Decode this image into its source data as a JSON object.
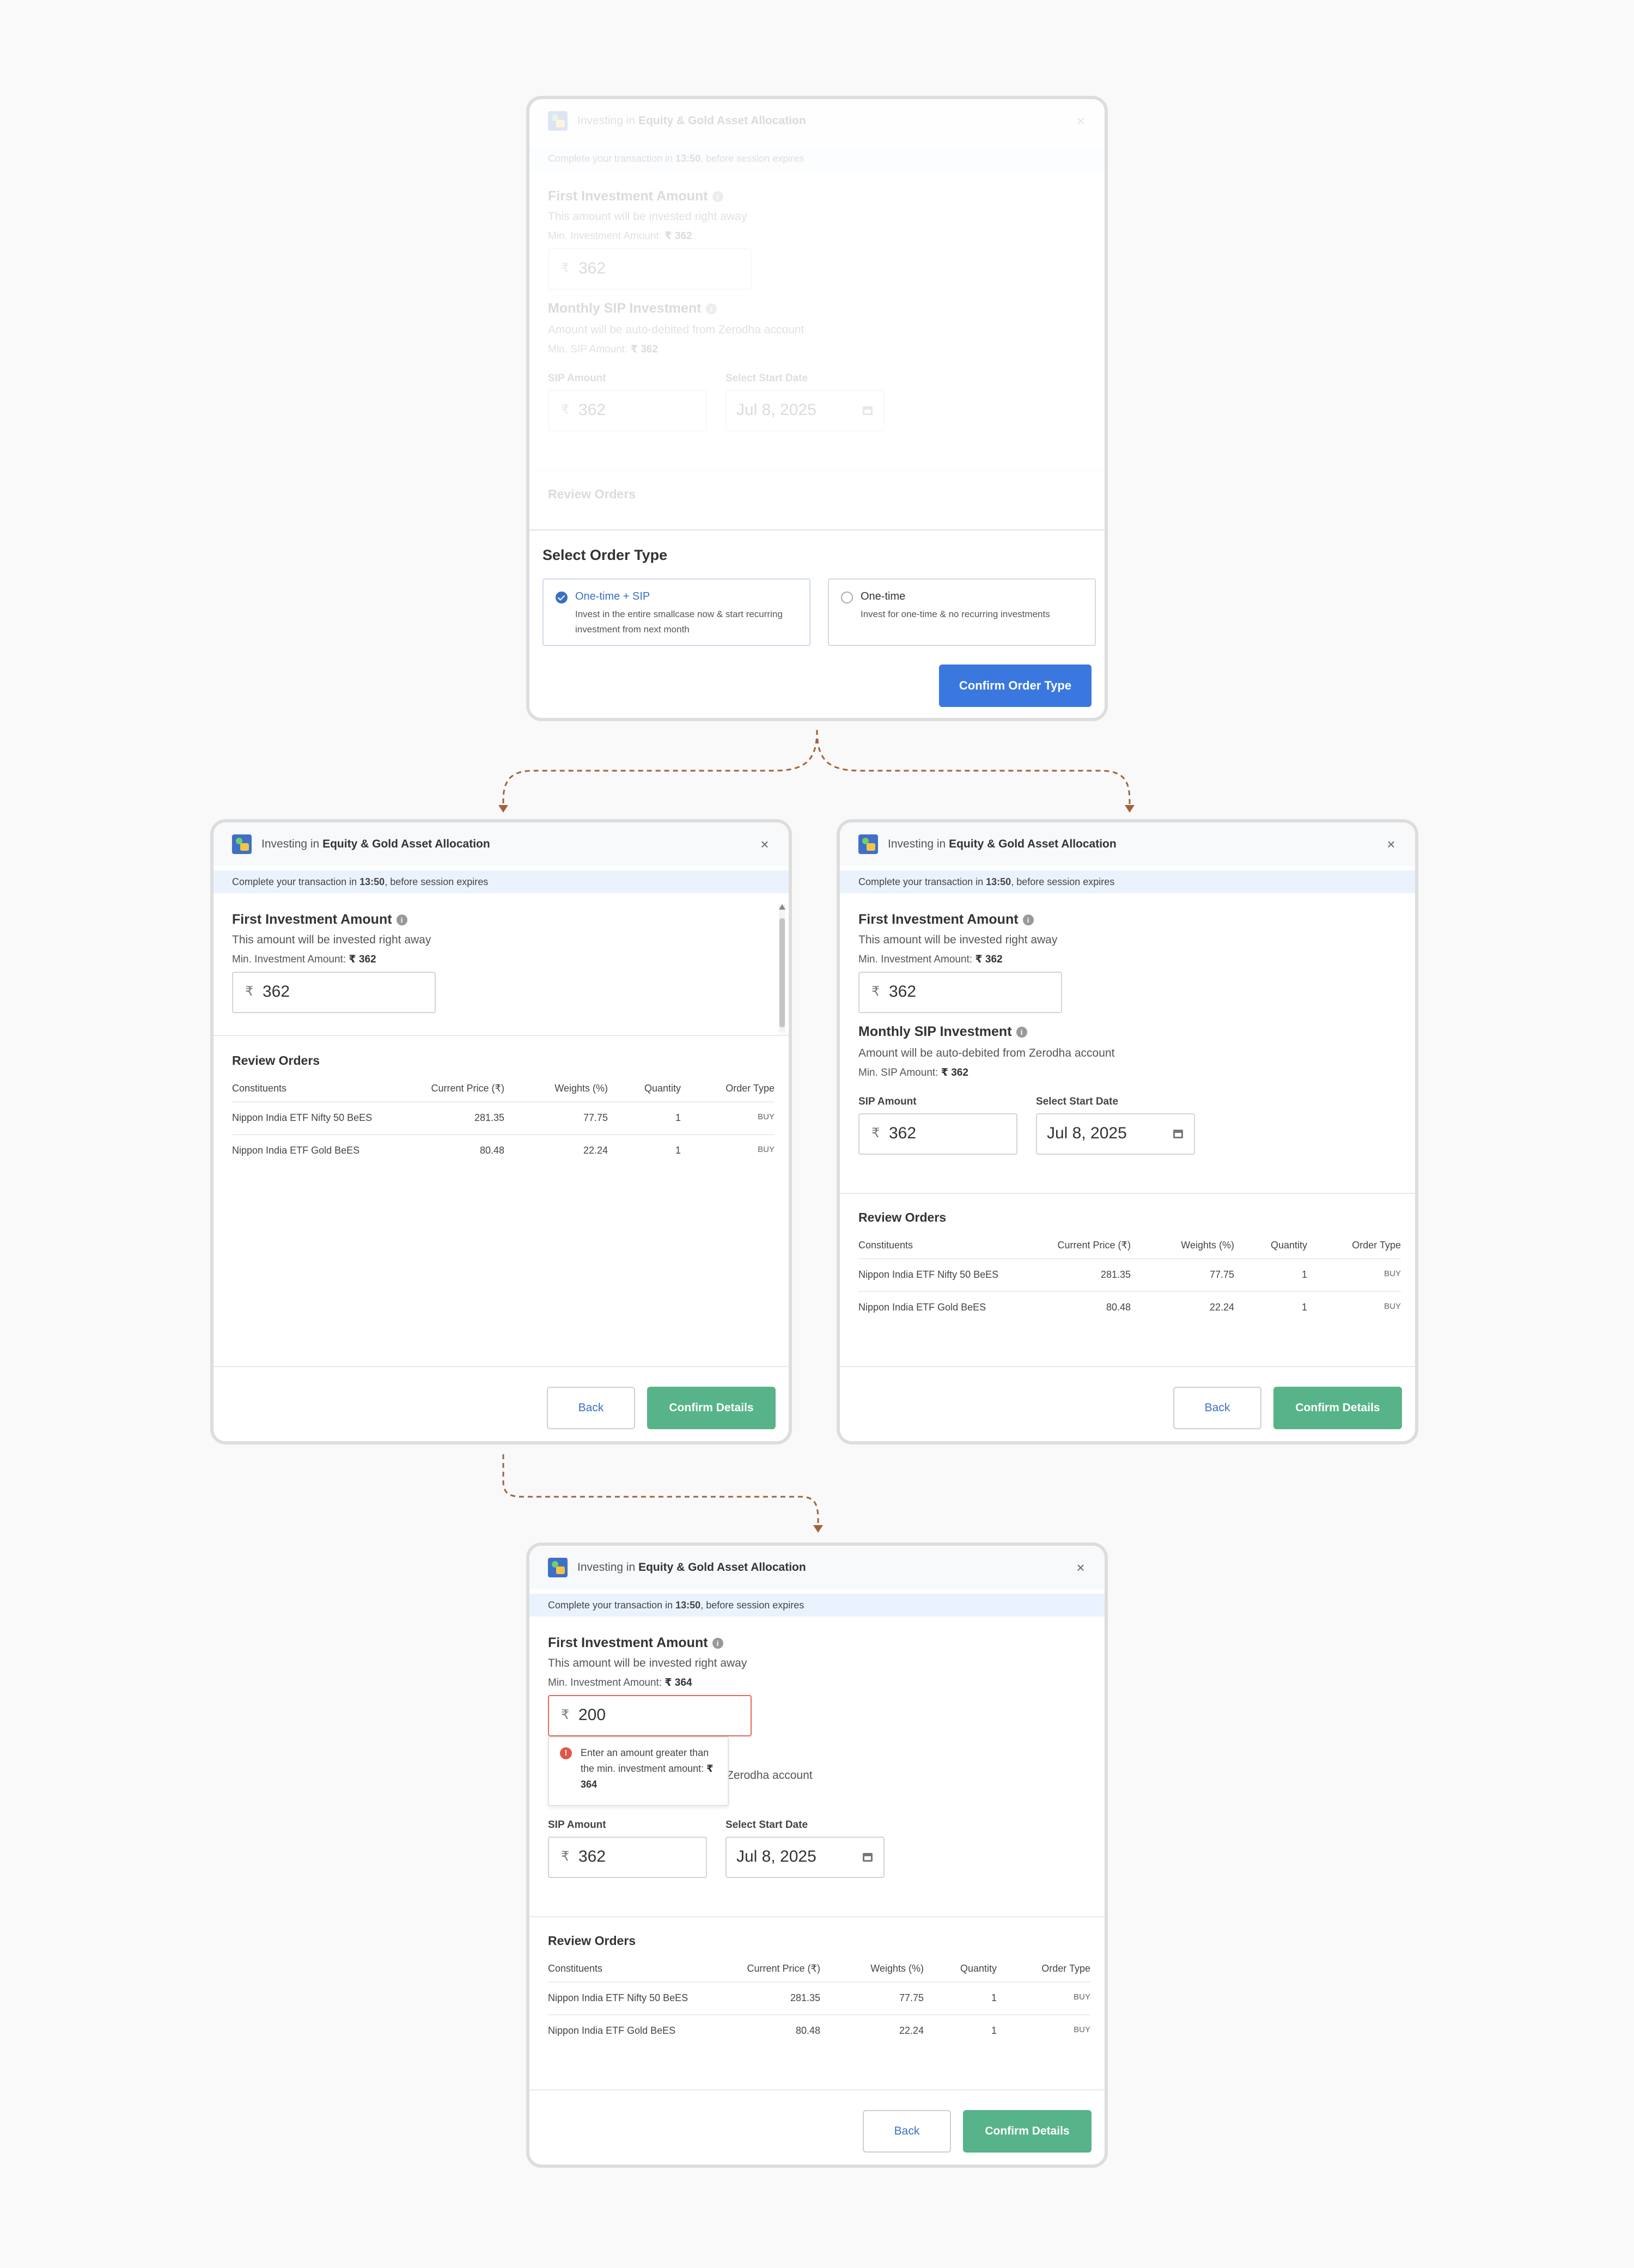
{
  "common": {
    "investing_in_prefix": "Investing in",
    "basket_name": "Equity & Gold Asset Allocation",
    "close_icon": "close-icon",
    "banner_prefix": "Complete your transaction in",
    "banner_time": "13:50",
    "banner_suffix": ", before session expires",
    "first_investment_title": "First Investment Amount",
    "first_investment_sub": "This amount will be invested right away",
    "min_investment_label": "Min. Investment Amount:",
    "monthly_sip_title": "Monthly SIP Investment",
    "monthly_sip_sub": "Amount will be auto-debited from Zerodha account",
    "min_sip_label": "Min. SIP Amount:",
    "sip_amount_label": "SIP Amount",
    "start_date_label": "Select Start Date",
    "start_date_value": "Jul 8, 2025",
    "currency_symbol": "₹",
    "review_orders_title": "Review Orders",
    "back_label": "Back",
    "confirm_details_label": "Confirm Details",
    "table_headers": [
      "Constituents",
      "Current Price (₹)",
      "Weights (%)",
      "Quantity",
      "Order Type"
    ],
    "rows": [
      {
        "name": "Nippon India ETF Nifty 50 BeES",
        "price": "281.35",
        "weight": "77.75",
        "qty": "1",
        "type": "BUY"
      },
      {
        "name": "Nippon India ETF Gold BeES",
        "price": "80.48",
        "weight": "22.24",
        "qty": "1",
        "type": "BUY"
      }
    ]
  },
  "screen1": {
    "min_investment_value": "₹ 362",
    "first_amount": "362",
    "min_sip_value": "₹ 362",
    "sip_amount": "362",
    "sheet_title": "Select Order Type",
    "options": [
      {
        "label": "One-time + SIP",
        "desc": "Invest in the entire smallcase now & start recurring investment from next month",
        "selected": true
      },
      {
        "label": "One-time",
        "desc": "Invest for one-time & no recurring investments",
        "selected": false
      }
    ],
    "confirm_order_type_label": "Confirm Order Type"
  },
  "screen2": {
    "min_investment_value": "₹ 362",
    "first_amount": "362"
  },
  "screen3": {
    "min_investment_value": "₹ 362",
    "first_amount": "362",
    "min_sip_value": "₹ 362",
    "sip_amount": "362"
  },
  "screen4": {
    "min_investment_value": "₹ 364",
    "first_amount": "200",
    "visible_sip_sub_tail": "Zerodha account",
    "error_text": "Enter an amount greater than the min. investment amount:",
    "error_value": "₹ 364",
    "sip_amount": "362"
  },
  "colors": {
    "primary_blue": "#3a78e0",
    "confirm_green": "#57b38a",
    "banner_blue": "#eaf3fd",
    "error_red": "#e06a5b",
    "flow_arrow": "#a0623c"
  }
}
